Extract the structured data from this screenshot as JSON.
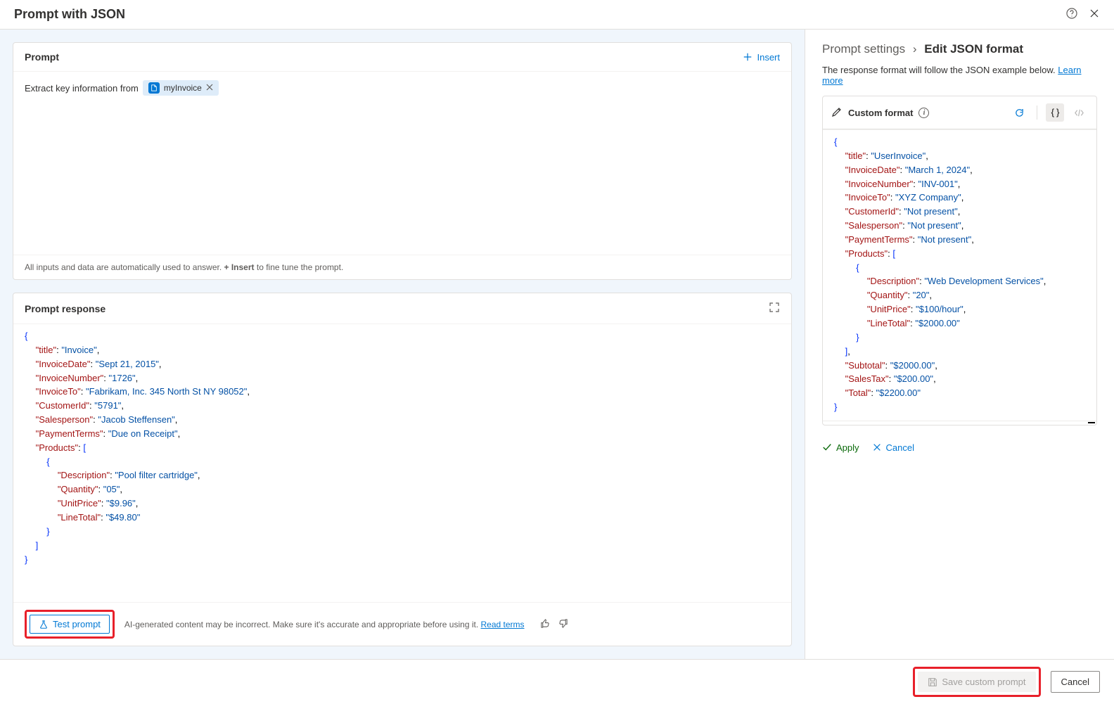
{
  "page_title": "Prompt with JSON",
  "prompt": {
    "section_title": "Prompt",
    "insert_label": "Insert",
    "text_before_chip": "Extract key information from",
    "chip_label": "myInvoice",
    "hint_before": "All inputs and data are automatically used to answer. ",
    "hint_bold": "+ Insert",
    "hint_after": " to fine tune the prompt."
  },
  "response": {
    "section_title": "Prompt response",
    "json": {
      "title": "Invoice",
      "InvoiceDate": "Sept 21, 2015",
      "InvoiceNumber": "1726",
      "InvoiceTo": "Fabrikam, Inc. 345 North St NY 98052",
      "CustomerId": "5791",
      "Salesperson": "Jacob Steffensen",
      "PaymentTerms": "Due on Receipt",
      "Products": [
        {
          "Description": "Pool filter cartridge",
          "Quantity": "05",
          "UnitPrice": "$9.96",
          "LineTotal": "$49.80"
        }
      ]
    },
    "test_label": "Test prompt",
    "disclaimer": "AI-generated content may be incorrect. Make sure it's accurate and appropriate before using it. ",
    "read_terms": "Read terms"
  },
  "settings": {
    "breadcrumb_root": "Prompt settings",
    "breadcrumb_leaf": "Edit JSON format",
    "description": "The response format will follow the JSON example below. ",
    "learn_more": "Learn more",
    "custom_format_title": "Custom format",
    "json": {
      "title": "UserInvoice",
      "InvoiceDate": "March 1, 2024",
      "InvoiceNumber": "INV-001",
      "InvoiceTo": "XYZ Company",
      "CustomerId": "Not present",
      "Salesperson": "Not present",
      "PaymentTerms": "Not present",
      "Products": [
        {
          "Description": "Web Development Services",
          "Quantity": "20",
          "UnitPrice": "$100/hour",
          "LineTotal": "$2000.00"
        }
      ],
      "Subtotal": "$2000.00",
      "SalesTax": "$200.00",
      "Total": "$2200.00"
    },
    "apply_label": "Apply",
    "cancel_label": "Cancel"
  },
  "bottom": {
    "save_label": "Save custom prompt",
    "cancel_label": "Cancel"
  }
}
